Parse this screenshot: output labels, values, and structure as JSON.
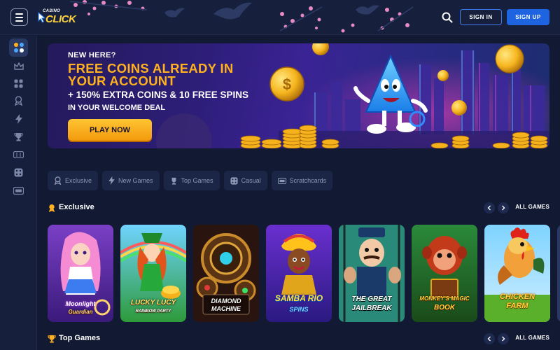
{
  "header": {
    "logo_top": "CASINO",
    "logo_main": "CLICK",
    "signin_label": "SIGN IN",
    "signup_label": "SIGN UP",
    "icons": [
      "menu-icon",
      "search-icon"
    ]
  },
  "sidebar": {
    "items": [
      {
        "icon": "lobby-icon",
        "active": true
      },
      {
        "icon": "crown-icon"
      },
      {
        "icon": "grid-icon"
      },
      {
        "icon": "exclusive-icon"
      },
      {
        "icon": "lightning-icon"
      },
      {
        "icon": "trophy-icon"
      },
      {
        "icon": "slot-icon"
      },
      {
        "icon": "dice-icon"
      },
      {
        "icon": "scratchcard-icon"
      }
    ]
  },
  "banner": {
    "eyebrow": "NEW HERE?",
    "headline": "FREE COINS ALREADY IN YOUR ACCOUNT",
    "subline": "+ 150% EXTRA COINS & 10 FREE SPINS",
    "subline2": "IN YOUR WELCOME DEAL",
    "cta": "PLAY NOW"
  },
  "filters": [
    {
      "label": "Exclusive",
      "icon": "exclusive-icon"
    },
    {
      "label": "New Games",
      "icon": "lightning-icon"
    },
    {
      "label": "Top Games",
      "icon": "trophy-icon"
    },
    {
      "label": "Casual",
      "icon": "dice-icon"
    },
    {
      "label": "Scratchcards",
      "icon": "scratchcard-icon"
    }
  ],
  "sections": [
    {
      "title": "Exclusive",
      "all_label": "ALL GAMES"
    },
    {
      "title": "Top Games",
      "all_label": "ALL GAMES"
    }
  ],
  "games": [
    {
      "line1": "Moonlight",
      "line2": "Guardian"
    },
    {
      "line1": "LUCKY LUCY",
      "line2": "RAINBOW PARTY"
    },
    {
      "line1": "DIAMOND",
      "line2": "MACHINE"
    },
    {
      "line1": "SAMBA RIO",
      "line2": "SPINS"
    },
    {
      "line1": "THE GREAT",
      "line2": "JAILBREAK"
    },
    {
      "line1": "MONKEY'S MAGIC",
      "line2": "BOOK"
    },
    {
      "line1": "CHICKEN",
      "line2": "FARM"
    }
  ],
  "colors": {
    "background": "#121a33",
    "panel": "#16203d",
    "accent_blue": "#1e63e0",
    "cta_orange": "#ffb11f",
    "headline_gold": "#ffb11f"
  }
}
